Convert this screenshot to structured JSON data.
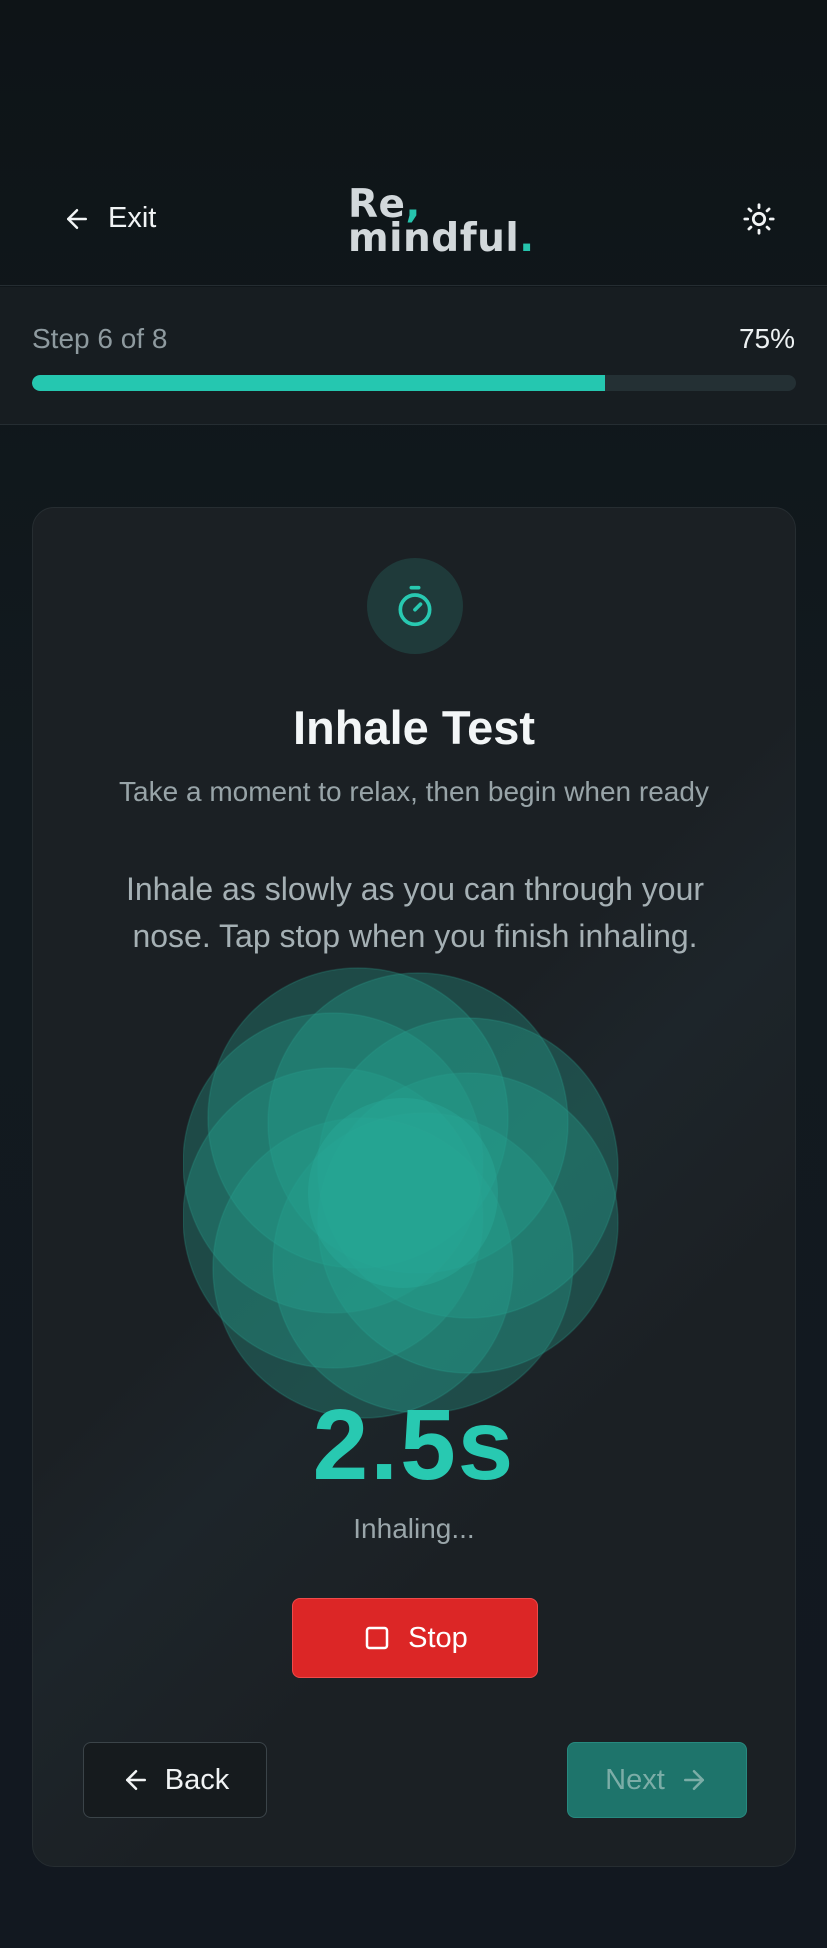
{
  "header": {
    "exit_label": "Exit",
    "logo_line1": "Re",
    "logo_line2": "mindful",
    "logo_comma": ",",
    "logo_period": "."
  },
  "progress": {
    "step_text": "Step 6 of 8",
    "percent_text": "75%",
    "value": 0.75,
    "fill_color": "#25c7b0"
  },
  "card": {
    "icon": "timer-icon",
    "title": "Inhale Test",
    "subtitle": "Take a moment to relax, then begin when ready",
    "instructions": "Inhale as slowly as you can through your nose. Tap stop when you finish inhaling.",
    "time_readout": "2.5s",
    "status": "Inhaling...",
    "stop_label": "Stop",
    "back_label": "Back",
    "next_label": "Next"
  },
  "colors": {
    "accent": "#25c7b0",
    "stop": "#dc2626",
    "background": "#10161b",
    "card": "#1b2024"
  },
  "icons": {
    "exit": "arrow-left-icon",
    "theme": "sun-icon",
    "stop": "square-icon",
    "back": "arrow-left-icon",
    "next": "arrow-right-icon"
  }
}
